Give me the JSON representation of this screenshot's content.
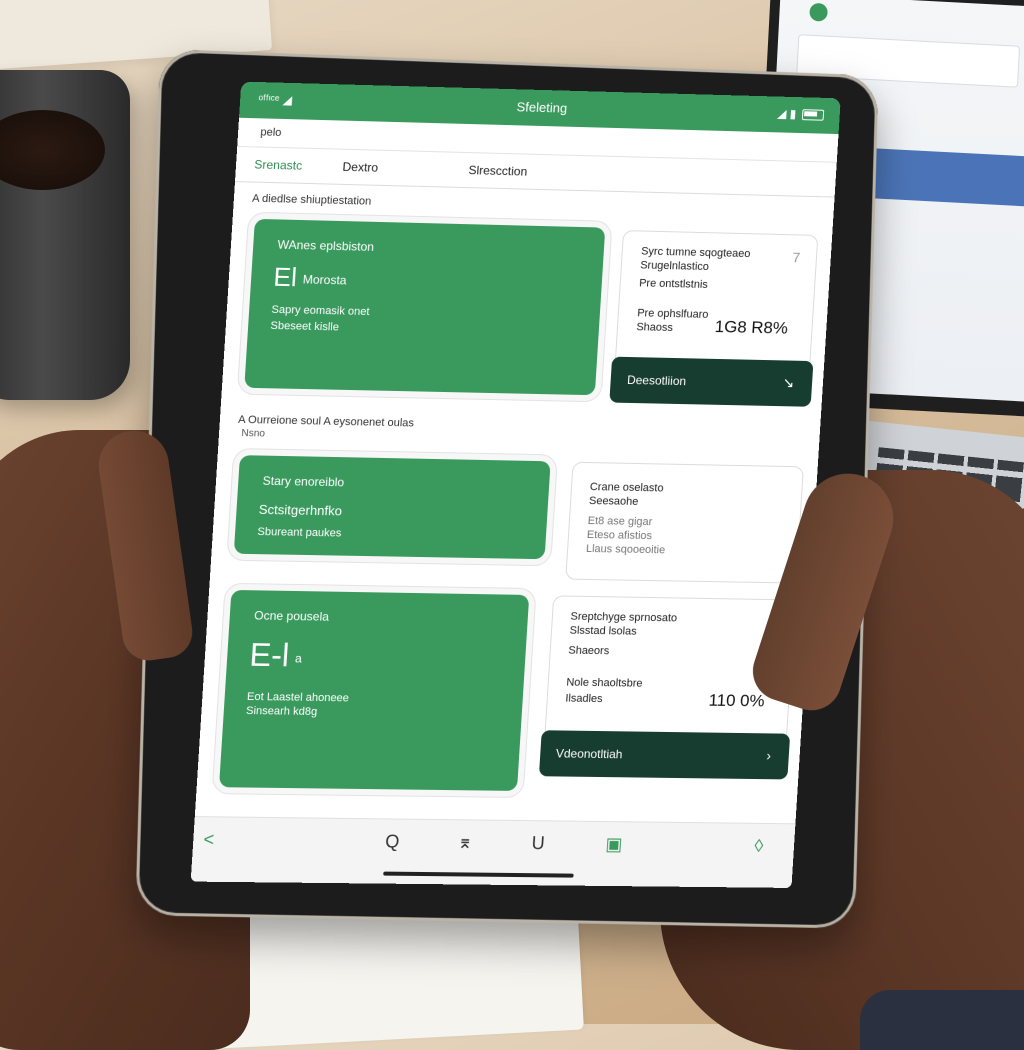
{
  "status": {
    "left": "ᵒᶠᶠᶦᶜᵉ ◢",
    "title": "Sfeleting",
    "right": "◢ ▮"
  },
  "breadcrumb": "pelo",
  "tabs": [
    {
      "label": "Srenastc",
      "active": true
    },
    {
      "label": "Dextro",
      "active": false
    },
    {
      "label": "Slrescction",
      "active": false
    }
  ],
  "section1": {
    "title": "A diedlse shiuptiestation"
  },
  "card1": {
    "title": "WAnes eplsbiston",
    "big": "El",
    "big_small": "Morosta",
    "line1": "Sapry eomasik   onet",
    "line2": "Sbeseet kislle"
  },
  "card2": {
    "line1": "Syrc tumne sqogteaeo",
    "line2": "Srugelnlastico",
    "line3": "Pre ontstlstnis",
    "line4": "Pre ophslfuaro",
    "line5": "Shaoss",
    "number": "1G8 R8%",
    "button": "Deesotliion",
    "chevron": "7"
  },
  "section2": {
    "title": "A Ourreione soul A eysonenet oulas",
    "sub": "Nsno"
  },
  "card3": {
    "title": "Stary enoreiblo",
    "line1": "Sctsitgerhnfko",
    "line2": "Sbureant   paukes"
  },
  "card4": {
    "line1": "Crane oselasto",
    "line2": "Seesaohe",
    "line3": "Et8 ase gigar",
    "line4": "Eteso afistios",
    "line5": "Llaus sqooeoitie"
  },
  "card5": {
    "title": "Ocne pousela",
    "big": "E-l",
    "big_small": "a",
    "line1": "Eot Laastel   ahoneee",
    "line2": "Sinsearh kd8g"
  },
  "card6": {
    "line1": "Sreptchyge sprnosato",
    "line2": "Slsstad lsolas",
    "line3": "Shaeors",
    "line4": "Nole shaoltsbre",
    "line5": "Ilsadles",
    "number": "110 0%",
    "button": "Vdeonotltiah",
    "chevron": "7"
  },
  "nav": {
    "back": "<",
    "search": "Q",
    "chart": "⌆",
    "shield": "U",
    "save": "▣",
    "drop": "◊"
  },
  "colors": {
    "accent": "#3a9a5e",
    "dark": "#173d30"
  }
}
